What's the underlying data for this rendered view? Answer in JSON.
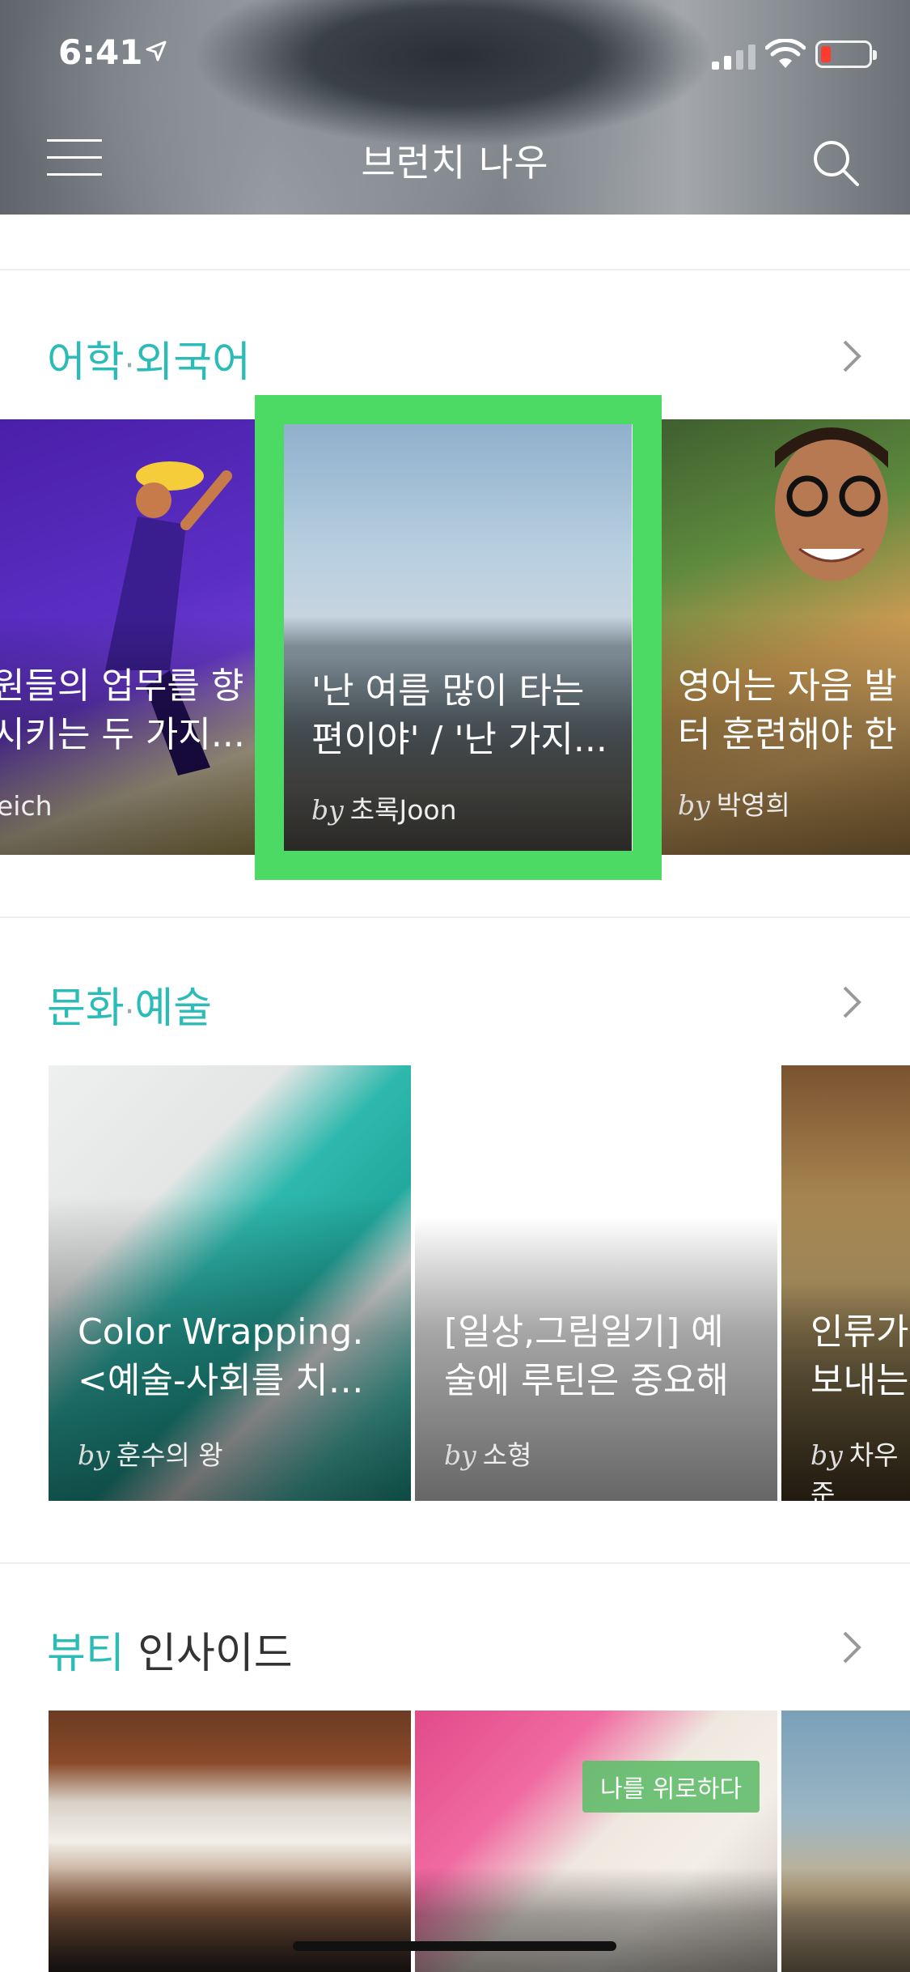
{
  "status_bar": {
    "time": "6:41"
  },
  "nav": {
    "title": "브런치 나우"
  },
  "sections": [
    {
      "title_teal": "어학",
      "title_dot": "·",
      "title_teal2": "외국어",
      "cards": [
        {
          "title": "원들의 업무를 향\n시키는 두 가지...",
          "author": "eich"
        },
        {
          "title": "'난 여름 많이 타는\n편이야' / '난 가지...",
          "by": "by",
          "author": "초록Joon"
        },
        {
          "title": "영어는 자음 발\n터 훈련해야 한",
          "by": "by",
          "author": "박영희"
        }
      ]
    },
    {
      "title_teal": "문화",
      "title_dot": "·",
      "title_teal2": "예술",
      "cards": [
        {
          "title": "Color Wrapping.\n<예술-사회를 치…",
          "by": "by",
          "author": "훈수의 왕"
        },
        {
          "title": "[일상,그림일기] 예\n술에 루틴은 중요해",
          "by": "by",
          "author": "소형"
        },
        {
          "title": "인류가\n보내는",
          "by": "by",
          "author": "차우준"
        }
      ]
    },
    {
      "title_teal": "뷰티",
      "title_dark": " 인사이드",
      "cards": [
        {
          "title": ""
        },
        {
          "title": "",
          "tag": "나를 위로하다"
        },
        {
          "title": ""
        }
      ]
    }
  ]
}
